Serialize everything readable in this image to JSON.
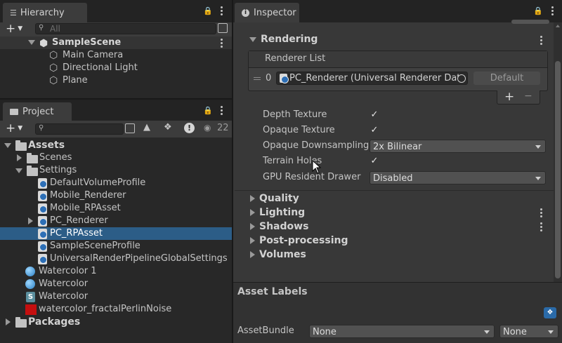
{
  "hierarchy": {
    "tab_label": "Hierarchy",
    "search_placeholder": "All",
    "scene": "SampleScene",
    "items": [
      "Main Camera",
      "Directional Light",
      "Plane"
    ]
  },
  "project": {
    "tab_label": "Project",
    "visible_count": "22",
    "tree": {
      "assets": "Assets",
      "scenes": "Scenes",
      "settings": "Settings",
      "settings_items": [
        "DefaultVolumeProfile",
        "Mobile_Renderer",
        "Mobile_RPAsset",
        "PC_Renderer",
        "PC_RPAsset",
        "SampleSceneProfile",
        "UniversalRenderPipelineGlobalSettings"
      ],
      "asset_items": [
        "Watercolor 1",
        "Watercolor",
        "Watercolor",
        "watercolor_fractalPerlinNoise"
      ],
      "packages": "Packages"
    },
    "selected": "PC_RPAsset"
  },
  "inspector": {
    "tab_label": "Inspector",
    "rendering": {
      "title": "Rendering",
      "renderer_list_label": "Renderer List",
      "renderer_index": "0",
      "renderer_value": "PC_Renderer (Universal Renderer Dat",
      "default_button": "Default",
      "add_label": "+",
      "remove_label": "−",
      "fields": {
        "depth_texture": "Depth Texture",
        "opaque_texture": "Opaque Texture",
        "opaque_downsampling": "Opaque Downsampling",
        "opaque_downsampling_value": "2x Bilinear",
        "terrain_holes": "Terrain Holes",
        "gpu_resident_drawer": "GPU Resident Drawer",
        "gpu_resident_drawer_value": "Disabled"
      }
    },
    "sections": [
      "Quality",
      "Lighting",
      "Shadows",
      "Post-processing",
      "Volumes"
    ],
    "asset_labels": {
      "title": "Asset Labels",
      "assetbundle_label": "AssetBundle",
      "assetbundle_value": "None",
      "variant_value": "None"
    }
  }
}
